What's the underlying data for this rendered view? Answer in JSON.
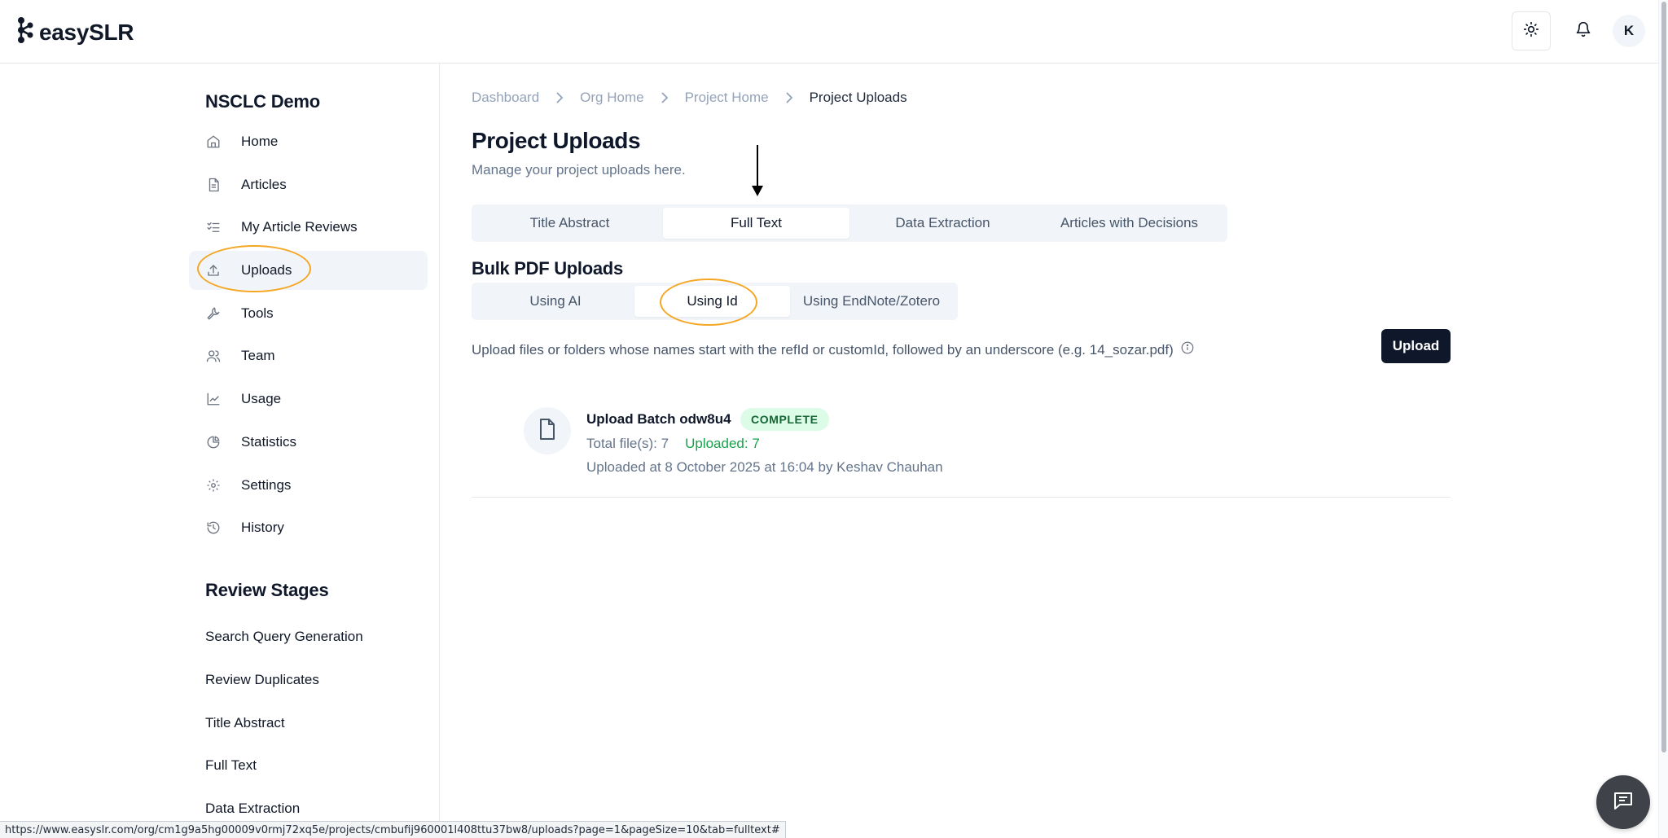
{
  "app": {
    "logo_text": "easySLR"
  },
  "header": {
    "avatar_initial": "K",
    "theme_icon": "sun-icon",
    "notification_icon": "bell-icon"
  },
  "sidebar": {
    "project_name": "NSCLC Demo",
    "items": [
      {
        "label": "Home",
        "icon": "home-icon"
      },
      {
        "label": "Articles",
        "icon": "document-icon"
      },
      {
        "label": "My Article Reviews",
        "icon": "list-check-icon"
      },
      {
        "label": "Uploads",
        "icon": "upload-icon"
      },
      {
        "label": "Tools",
        "icon": "wrench-icon"
      },
      {
        "label": "Team",
        "icon": "users-icon"
      },
      {
        "label": "Usage",
        "icon": "chart-line-icon"
      },
      {
        "label": "Statistics",
        "icon": "pie-chart-icon"
      },
      {
        "label": "Settings",
        "icon": "gear-icon"
      },
      {
        "label": "History",
        "icon": "history-icon"
      }
    ],
    "active_item": "Uploads",
    "stages_title": "Review Stages",
    "stages": [
      "Search Query Generation",
      "Review Duplicates",
      "Title Abstract",
      "Full Text",
      "Data Extraction"
    ]
  },
  "breadcrumb": [
    "Dashboard",
    "Org Home",
    "Project Home",
    "Project Uploads"
  ],
  "page": {
    "title": "Project Uploads",
    "subtitle": "Manage your project uploads here."
  },
  "tabs": [
    "Title Abstract",
    "Full Text",
    "Data Extraction",
    "Articles with Decisions"
  ],
  "active_tab": "Full Text",
  "bulk": {
    "title": "Bulk PDF Uploads",
    "subtabs": [
      "Using AI",
      "Using Id",
      "Using EndNote/Zotero"
    ],
    "active_subtab": "Using Id",
    "help_text": "Upload files or folders whose names start with the refId or customId, followed by an underscore (e.g. 14_sozar.pdf)",
    "upload_button": "Upload"
  },
  "batch": {
    "title": "Upload Batch odw8u4",
    "status": "COMPLETE",
    "total": "Total file(s): 7",
    "uploaded": "Uploaded: 7",
    "meta": "Uploaded at 8 October 2025 at 16:04 by Keshav Chauhan"
  },
  "status_url": "https://www.easyslr.com/org/cm1g9a5hg00009v0rmj72xq5e/projects/cmbufij960001l408ttu37bw8/uploads?page=1&pageSize=10&tab=fulltext#",
  "colors": {
    "accent": "#0f172a",
    "highlight_ring": "#f5a623",
    "success_bg": "#dcfce7",
    "success_text": "#16a34a"
  }
}
